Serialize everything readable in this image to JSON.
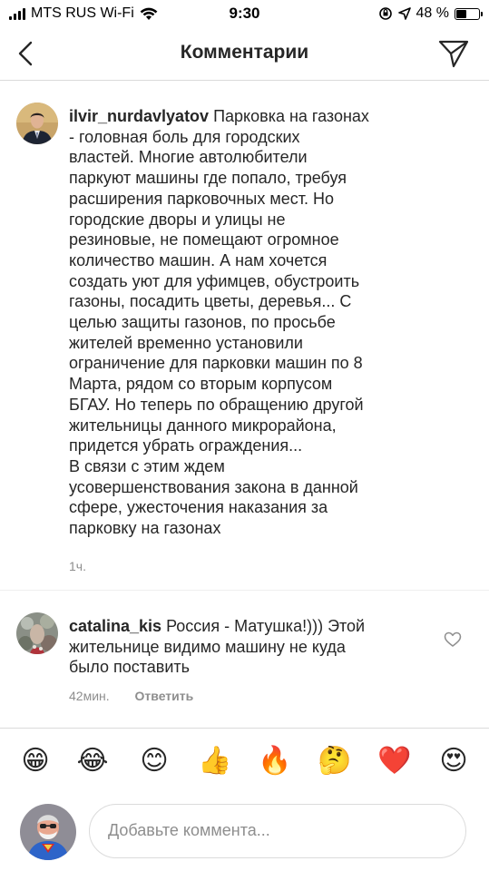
{
  "status_bar": {
    "carrier": "MTS RUS Wi-Fi",
    "time": "9:30",
    "battery_percent": "48 %",
    "battery_level": 0.48
  },
  "header": {
    "title": "Комментарии"
  },
  "caption": {
    "username": "ilvir_nurdavlyatov",
    "text_lines": [
      "ilvir_nurdavlyatov Парковка на газонах",
      "- головная боль для городских",
      "властей. Многие автолюбители",
      "паркуют машины где попало, требуя",
      "расширения парковочных мест. Но",
      "городские дворы и улицы не",
      "резиновые, не помещают огромное",
      "количество машин. А нам хочется",
      "создать уют для уфимцев, обустроить",
      "газоны, посадить цветы, деревья... С",
      "целью защиты газонов, по просьбе",
      "жителей временно установили",
      "ограничение для парковки машин по 8",
      "Марта, рядом со вторым корпусом",
      "БГАУ. Но теперь по обращению другой",
      "жительницы данного микрорайона,",
      "придется убрать ограждения..."
    ],
    "text_p1_rest": " Парковка на газонах\n- головная боль для городских\nвластей. Многие автолюбители\nпаркуют машины где попало, требуя\nрасширения парковочных мест. Но\nгородские дворы и улицы не\nрезиновые, не помещают огромное\nколичество машин. А нам хочется\nсоздать уют для уфимцев, обустроить\nгазоны, посадить цветы, деревья... С\nцелью защиты газонов, по просьбе\nжителей временно установили\nограничение для парковки машин по 8\nМарта, рядом со вторым корпусом\nБГАУ. Но теперь по обращению другой\nжительницы данного микрорайона,\nпридется убрать ограждения...",
    "text_p2": "В связи с этим ждем\nусовершенствования закона в данной\nсфере, ужесточения наказания за\nпарковку на газонах",
    "time": "1ч."
  },
  "reply": {
    "username": "catalina_kis",
    "text": " Россия - Матушка!))) Этой\nжительнице видимо машину не куда\nбыло поставить",
    "time": "42мин.",
    "reply_label": "Ответить",
    "like_icon": "heart-outline-icon"
  },
  "emoji_bar": {
    "emojis": [
      "😁",
      "😂",
      "😊",
      "👍",
      "🔥",
      "🤔",
      "❤️",
      "😍"
    ]
  },
  "composer": {
    "placeholder": "Добавьте коммента..."
  }
}
